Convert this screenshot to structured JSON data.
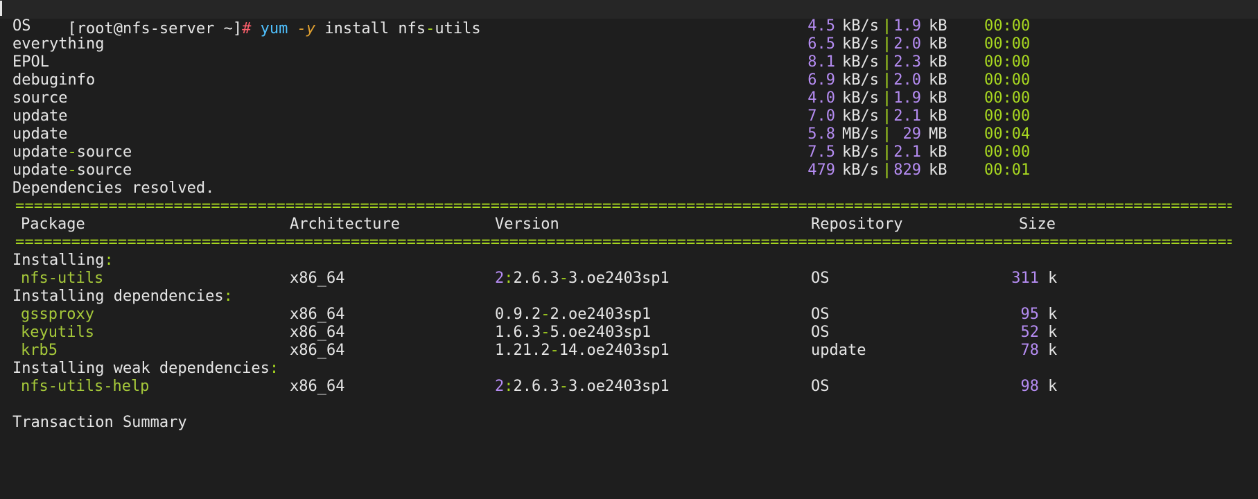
{
  "prompt": {
    "user_host": "[root@nfs-server ~]",
    "symbol": "#",
    "cmd": "yum",
    "flag": "-y",
    "args": "install nfs",
    "dash": "-",
    "args2": "utils"
  },
  "repos": [
    {
      "name": "OS",
      "name_suffix": "",
      "rate": "4.5",
      "rate_unit": "kB/s",
      "pipe": "|",
      "size": "1.9",
      "size_unit": "kB",
      "time": "00:00"
    },
    {
      "name": "everything",
      "name_suffix": "",
      "rate": "6.5",
      "rate_unit": "kB/s",
      "pipe": "|",
      "size": "2.0",
      "size_unit": "kB",
      "time": "00:00"
    },
    {
      "name": "EPOL",
      "name_suffix": "",
      "rate": "8.1",
      "rate_unit": "kB/s",
      "pipe": "|",
      "size": "2.3",
      "size_unit": "kB",
      "time": "00:00"
    },
    {
      "name": "debuginfo",
      "name_suffix": "",
      "rate": "6.9",
      "rate_unit": "kB/s",
      "pipe": "|",
      "size": "2.0",
      "size_unit": "kB",
      "time": "00:00"
    },
    {
      "name": "source",
      "name_suffix": "",
      "rate": "4.0",
      "rate_unit": "kB/s",
      "pipe": "|",
      "size": "1.9",
      "size_unit": "kB",
      "time": "00:00"
    },
    {
      "name": "update",
      "name_suffix": "",
      "rate": "7.0",
      "rate_unit": "kB/s",
      "pipe": "|",
      "size": "2.1",
      "size_unit": "kB",
      "time": "00:00"
    },
    {
      "name": "update",
      "name_suffix": "",
      "rate": "5.8",
      "rate_unit": "MB/s",
      "pipe": "|",
      "size": "29",
      "size_unit": "MB",
      "time": "00:04"
    },
    {
      "name": "update",
      "name_suffix": "source",
      "rate": "7.5",
      "rate_unit": "kB/s",
      "pipe": "|",
      "size": "2.1",
      "size_unit": "kB",
      "time": "00:00"
    },
    {
      "name": "update",
      "name_suffix": "source",
      "rate": "479",
      "rate_unit": "kB/s",
      "pipe": "|",
      "size": "829",
      "size_unit": "kB",
      "time": "00:01"
    }
  ],
  "deps_resolved": "Dependencies resolved.",
  "rule": "==================================================================================================================================================",
  "headers": {
    "package": "Package",
    "architecture": "Architecture",
    "version": "Version",
    "repository": "Repository",
    "size": "Size"
  },
  "sections": {
    "installing": "Installing",
    "installing_deps": "Installing dependencies",
    "installing_weak": "Installing weak dependencies",
    "colon": ":"
  },
  "packages": [
    {
      "name": "nfs-utils",
      "arch": "x86_64",
      "epoch": "2",
      "ver_a": "2.6.3",
      "ver_b": "3.oe2403sp1",
      "repo": "OS",
      "size": "311",
      "unit": "k"
    },
    {
      "name": "gssproxy",
      "arch": "x86_64",
      "epoch": "",
      "ver_a": "0.9.2",
      "ver_b": "2.oe2403sp1",
      "repo": "OS",
      "size": "95",
      "unit": "k"
    },
    {
      "name": "keyutils",
      "arch": "x86_64",
      "epoch": "",
      "ver_a": "1.6.3",
      "ver_b": "5.oe2403sp1",
      "repo": "OS",
      "size": "52",
      "unit": "k"
    },
    {
      "name": "krb5",
      "arch": "x86_64",
      "epoch": "",
      "ver_a": "1.21.2",
      "ver_b": "14.oe2403sp1",
      "repo": "update",
      "size": "78",
      "unit": "k"
    },
    {
      "name": "nfs-utils-help",
      "arch": "x86_64",
      "epoch": "2",
      "ver_a": "2.6.3",
      "ver_b": "3.oe2403sp1",
      "repo": "OS",
      "size": "98",
      "unit": "k"
    }
  ],
  "transaction_summary": "Transaction Summary",
  "colors": {
    "background": "#1e1e1e",
    "text": "#e6e6e6",
    "prompt_symbol": "#ff5f6b",
    "command": "#4fc1ff",
    "flag": "#e0a030",
    "number": "#b58cf2",
    "accent_green": "#a8d820",
    "package_name": "#a6c93a"
  }
}
